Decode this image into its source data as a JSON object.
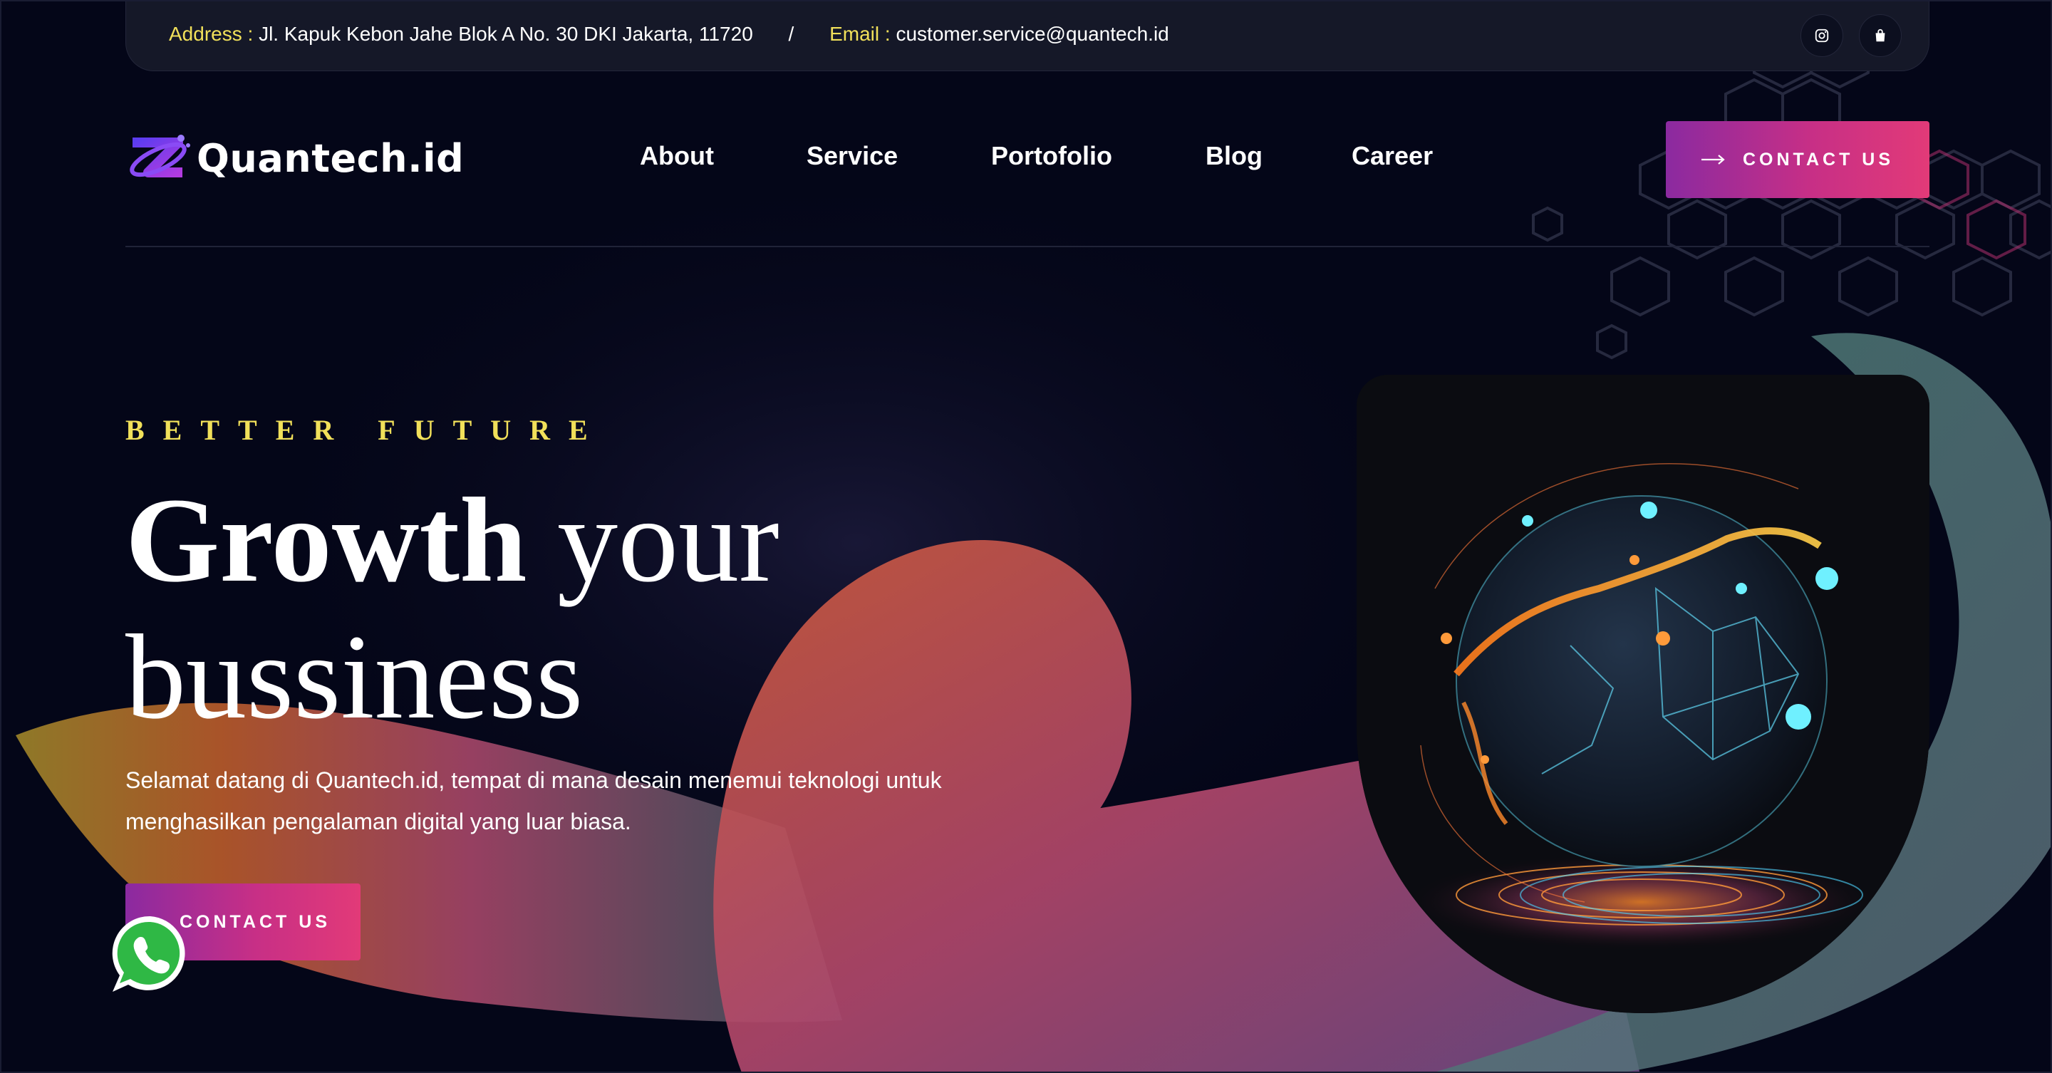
{
  "topbar": {
    "address_label": "Address :",
    "address_value": "Jl. Kapuk Kebon Jahe Blok A No. 30 DKI Jakarta, 11720",
    "separator": "/",
    "email_label": "Email :",
    "email_value": "customer.service@quantech.id",
    "icons": [
      "instagram-icon",
      "shopping-bag-icon"
    ]
  },
  "brand": {
    "name": "Quantech.id"
  },
  "nav": {
    "items": [
      {
        "label": "About"
      },
      {
        "label": "Service"
      },
      {
        "label": "Portofolio"
      },
      {
        "label": "Blog"
      },
      {
        "label": "Career"
      }
    ],
    "cta_label": "CONTACT US"
  },
  "hero": {
    "eyebrow": "BETTER FUTURE",
    "headline_bold": "Growth",
    "headline_rest": "your bussiness",
    "description": "Selamat datang di Quantech.id, tempat di mana desain menemui teknologi untuk menghasilkan pengalaman digital yang luar biasa.",
    "cta_label": "CONTACT US"
  },
  "colors": {
    "background": "#040618",
    "accent_yellow": "#f1e05a",
    "gradient_start": "#8b2aa0",
    "gradient_end": "#e23a78",
    "whatsapp_green": "#2fb845"
  }
}
